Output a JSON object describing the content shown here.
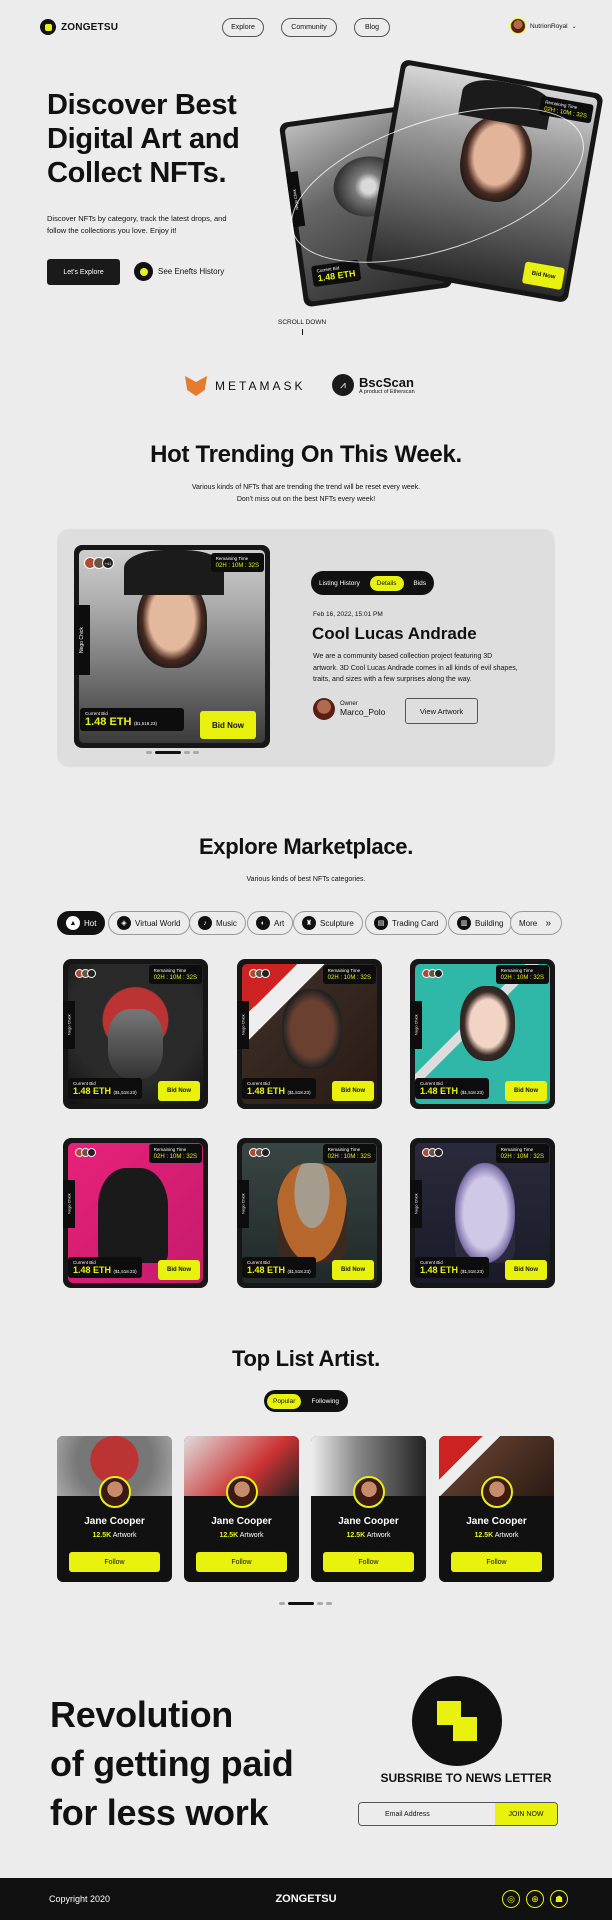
{
  "brand": "ZONGETSU",
  "nav": {
    "items": [
      "Explore",
      "Community",
      "Blog"
    ],
    "user": "NutrionRoyal"
  },
  "hero": {
    "title_lines": [
      "Discover Best",
      "Digital Art and",
      "Collect NFTs."
    ],
    "desc_lines": [
      "Discover NFTs by category, track the latest drops, and",
      "follow the collections you love. Enjoy it!"
    ],
    "cta": "Let's Explore",
    "history": "See Enefts History",
    "scroll": "SCROLL DOWN"
  },
  "partners": {
    "metamask": "METAMASK",
    "bsc": "BscScan",
    "bsc_sub": "A product of Etherscan"
  },
  "trending": {
    "title": "Hot Trending On This Week.",
    "sub_lines": [
      "Various kinds of NFTs that are trending the trend will be reset every week.",
      "Don't miss out on the best NFTs every week!"
    ],
    "tabs": [
      "Listing History",
      "Details",
      "Bids"
    ],
    "active_tab": "Details",
    "date": "Feb 16, 2022, 15:01 PM",
    "name": "Cool Lucas Andrade",
    "desc_lines": [
      "We are a community based collection project featuring 3D",
      "artwork. 3D Cool Lucas Andrade comes in all kinds of evil shapes,",
      "traits, and sizes with a few surprises along the way."
    ],
    "owner_label": "Owner",
    "owner": "Marco_Polo",
    "view": "View Artwork"
  },
  "card_common": {
    "remaining": "Remaining Time",
    "time": "02H : 10M : 32S",
    "bid_label": "Current Bid",
    "bid": "1.48 ETH",
    "usd": "($1,518.23)",
    "bid_btn": "Bid Now",
    "side": "Nego Chick",
    "count": "+41"
  },
  "marketplace": {
    "title": "Explore Marketplace.",
    "sub": "Various kinds of best NFTs categories.",
    "categories": [
      "Hot",
      "Virtual World",
      "Music",
      "Art",
      "Sculpture",
      "Trading Card",
      "Building",
      "More"
    ]
  },
  "artists": {
    "title": "Top List Artist.",
    "tabs": [
      "Popular",
      "Following"
    ],
    "items": [
      {
        "name": "Jane Cooper",
        "count": "12.5K",
        "unit": "Artwork",
        "btn": "Follow"
      },
      {
        "name": "Jane Cooper",
        "count": "12.5K",
        "unit": "Artwork",
        "btn": "Follow"
      },
      {
        "name": "Jane Cooper",
        "count": "12.5K",
        "unit": "Artwork",
        "btn": "Follow"
      },
      {
        "name": "Jane Cooper",
        "count": "12.5K",
        "unit": "Artwork",
        "btn": "Follow"
      }
    ]
  },
  "newsletter": {
    "headline_lines": [
      "Revolution",
      "of getting paid",
      "for less work"
    ],
    "title": "SUBSRIBE TO NEWS LETTER",
    "placeholder": "Email Address",
    "button": "JOIN NOW"
  },
  "footer": {
    "copyright": "Copyright 2020",
    "brand": "ZONGETSU"
  },
  "colors": {
    "accent": "#e8f20c",
    "dark": "#111111",
    "bg": "#ececec"
  }
}
